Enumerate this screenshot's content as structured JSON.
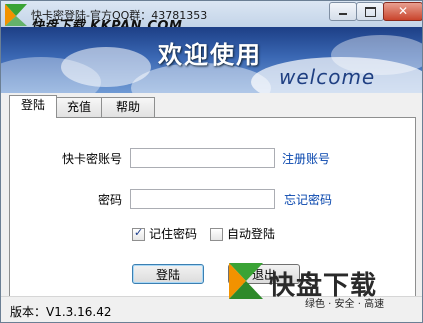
{
  "window": {
    "title": "快卡密登陆-官方QQ群：43781353",
    "watermark_top": "快盘下载 KKPAN.COM",
    "close_label": "✕"
  },
  "banner": {
    "title_cn": "欢迎使用",
    "title_en": "welcome"
  },
  "tabs": [
    {
      "label": "登陆",
      "active": true
    },
    {
      "label": "充值",
      "active": false
    },
    {
      "label": "帮助",
      "active": false
    }
  ],
  "form": {
    "account_label": "快卡密账号",
    "account_value": "",
    "register_link": "注册账号",
    "password_label": "密码",
    "password_value": "",
    "forgot_link": "忘记密码",
    "remember_label": "记住密码",
    "remember_checked": true,
    "autologin_label": "自动登陆",
    "autologin_checked": false,
    "login_button": "登陆",
    "exit_button": "退出"
  },
  "status": {
    "version": "版本：V1.3.16.42"
  },
  "logo": {
    "name": "快盘下载",
    "tagline": "绿色 · 安全 · 高速",
    "colors": {
      "green": "#3aa335",
      "orange": "#f29200"
    }
  }
}
